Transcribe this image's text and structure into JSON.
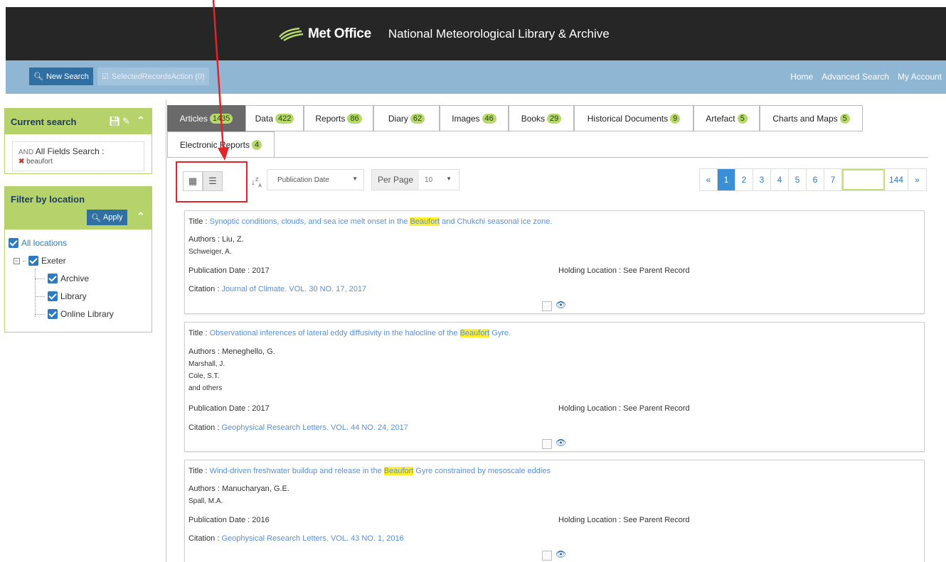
{
  "header": {
    "brand_name": "Met Office",
    "brand_sub": "National Meteorological Library & Archive"
  },
  "navbar": {
    "new_search": "New Search",
    "selected_action": "SelectedRecordsAction (0)",
    "links": [
      "Home",
      "Advanced Search",
      "My Account"
    ]
  },
  "current_search": {
    "title": "Current search",
    "operator": "AND",
    "field": "All Fields Search :",
    "term": "beaufort"
  },
  "filter": {
    "title": "Filter by location",
    "apply": "Apply",
    "items": [
      {
        "label": "All locations",
        "level": 0
      },
      {
        "label": "Exeter",
        "level": 1
      },
      {
        "label": "Archive",
        "level": 2
      },
      {
        "label": "Library",
        "level": 2
      },
      {
        "label": "Online Library",
        "level": 2
      }
    ]
  },
  "tabs": [
    {
      "label": "Articles",
      "count": "1435"
    },
    {
      "label": "Data",
      "count": "422"
    },
    {
      "label": "Reports",
      "count": "86"
    },
    {
      "label": "Diary",
      "count": "62"
    },
    {
      "label": "Images",
      "count": "46"
    },
    {
      "label": "Books",
      "count": "29"
    },
    {
      "label": "Historical Documents",
      "count": "9"
    },
    {
      "label": "Artefact",
      "count": "5"
    },
    {
      "label": "Charts and Maps",
      "count": "5"
    },
    {
      "label": "Electronic Reports",
      "count": "4"
    }
  ],
  "toolbar": {
    "sort_value": "Publication Date",
    "per_page_label": "Per Page",
    "per_page_value": "10"
  },
  "pagination": {
    "prev": "«",
    "pages": [
      "1",
      "2",
      "3",
      "4",
      "5",
      "6",
      "7"
    ],
    "last": "144",
    "next": "»"
  },
  "labels": {
    "title": "Title :",
    "authors": "Authors :",
    "pub_date": "Publication Date :",
    "holding": "Holding Location :",
    "citation": "Citation :"
  },
  "records": [
    {
      "title_pre": "Synoptic conditions, clouds, and sea ice melt onset in the ",
      "title_hl": "Beaufort",
      "title_post": " and Chukchi seasonal ice zone.",
      "authors": [
        "Liu, Z.",
        "Schweiger, A."
      ],
      "pub_date": "2017",
      "holding": "See Parent Record",
      "citation": "Journal of Climate. VOL. 30 NO. 17, 2017"
    },
    {
      "title_pre": "Observational inferences of lateral eddy diffusivity in the halocline of the ",
      "title_hl": "Beaufort",
      "title_post": " Gyre.",
      "authors": [
        "Meneghello, G.",
        "Marshall, J.",
        "Cole, S.T.",
        "and others"
      ],
      "pub_date": "2017",
      "holding": "See Parent Record",
      "citation": "Geophysical Research Letters. VOL. 44 NO. 24, 2017"
    },
    {
      "title_pre": "Wind-driven freshwater buildup and release in the ",
      "title_hl": "Beaufort",
      "title_post": " Gyre constrained by mesoscale eddies",
      "authors": [
        "Manucharyan, G.E.",
        "Spall, M.A."
      ],
      "pub_date": "2016",
      "holding": "See Parent Record",
      "citation": "Geophysical Research Letters. VOL. 43 NO. 1, 2016"
    }
  ],
  "colors": {
    "accent_green": "#b5d26b",
    "nav_blue": "#8fb6d3",
    "annotation_red": "#e0242b"
  }
}
